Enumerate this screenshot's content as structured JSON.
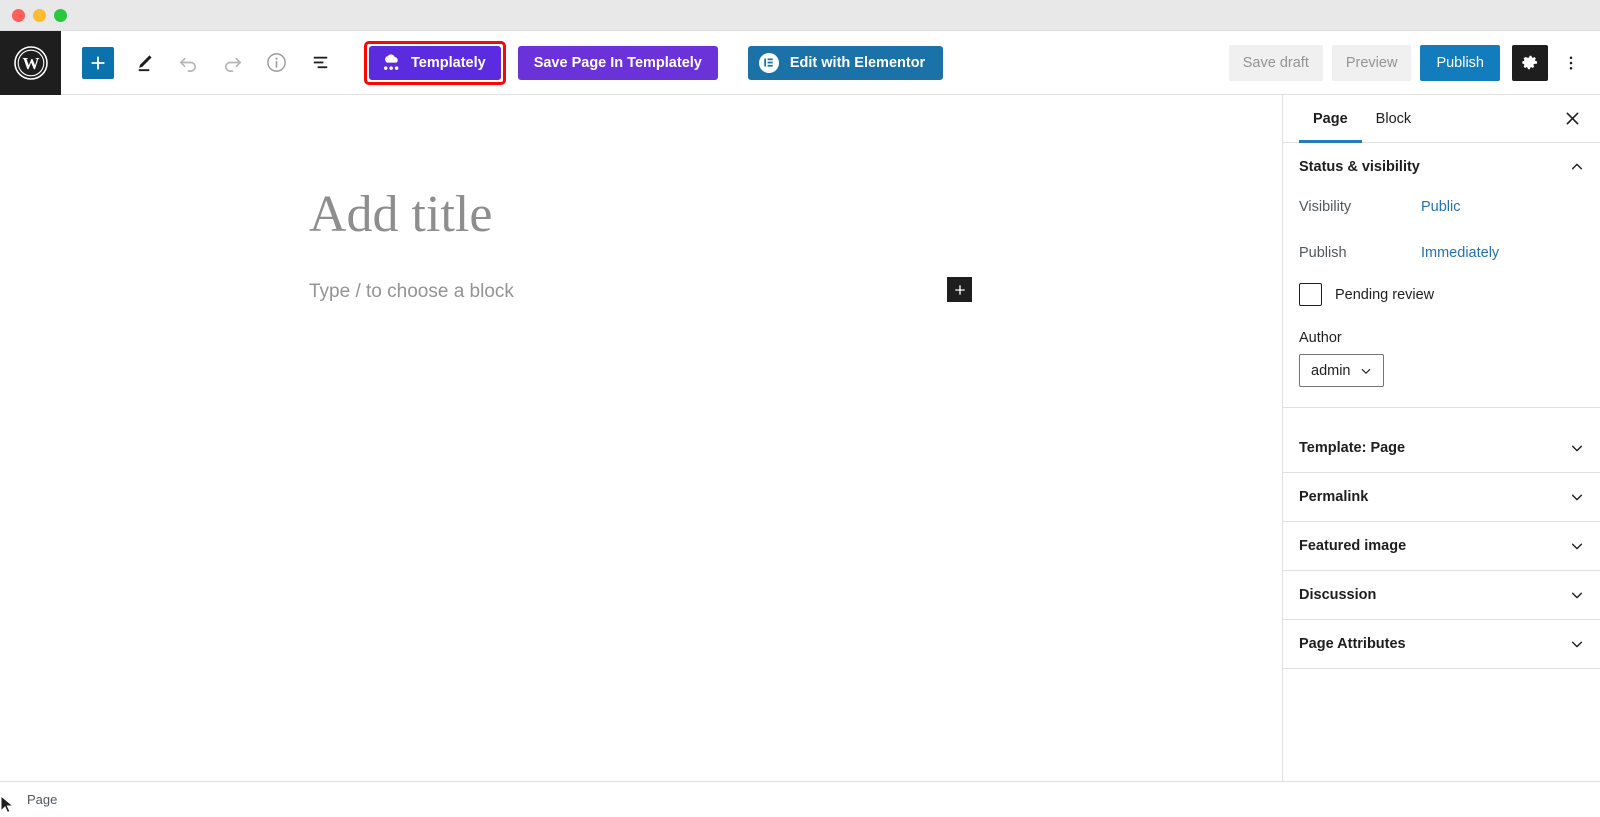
{
  "window": {
    "traffic_lights": [
      "close",
      "minimize",
      "maximize"
    ],
    "colors": {
      "close": "#ff5f57",
      "minimize": "#febc2e",
      "maximize": "#28c840"
    }
  },
  "toolbar": {
    "wp_logo": "wordpress-logo",
    "tools": [
      {
        "name": "block-inserter",
        "icon": "plus-icon",
        "label": "Toggle block inserter"
      },
      {
        "name": "tools-edit",
        "icon": "pencil-icon",
        "label": "Tools"
      },
      {
        "name": "undo",
        "icon": "undo-arrow-icon",
        "label": "Undo"
      },
      {
        "name": "redo",
        "icon": "redo-arrow-icon",
        "label": "Redo"
      },
      {
        "name": "details",
        "icon": "info-circle-icon",
        "label": "Details"
      },
      {
        "name": "list-view",
        "icon": "list-view-icon",
        "label": "List view"
      }
    ],
    "templately_label": "Templately",
    "save_page_templately_label": "Save Page In Templately",
    "edit_with_elementor_label": "Edit with Elementor",
    "save_draft_label": "Save draft",
    "preview_label": "Preview",
    "publish_label": "Publish",
    "settings_gear_label": "Settings",
    "more_options_label": "Options"
  },
  "highlight": {
    "target": "Templately",
    "border_color": "#fb0505"
  },
  "colors": {
    "templately_purple": "#5b2be0",
    "templately_save_purple": "#6a32d8",
    "elementor_blue": "#1a72a8",
    "publish_blue": "#137cbd",
    "inserter_blue": "#0b72ad",
    "accent_tab": "#1e7fb8",
    "link_blue": "#2271b1",
    "dark": "#1e1e1e"
  },
  "canvas": {
    "title_placeholder": "Add title",
    "block_placeholder": "Type / to choose a block",
    "inserter_icon": "plus-icon"
  },
  "sidebar": {
    "tabs": [
      {
        "label": "Page",
        "active": true
      },
      {
        "label": "Block",
        "active": false
      }
    ],
    "close_icon": "close-icon",
    "status_panel": {
      "title": "Status & visibility",
      "expanded": true,
      "rows": [
        {
          "label": "Visibility",
          "value": "Public"
        },
        {
          "label": "Publish",
          "value": "Immediately"
        }
      ],
      "pending_review": {
        "label": "Pending review",
        "checked": false
      },
      "author": {
        "label": "Author",
        "value": "admin"
      }
    },
    "panels": [
      {
        "title": "Template: Page",
        "expanded": false
      },
      {
        "title": "Permalink",
        "expanded": false
      },
      {
        "title": "Featured image",
        "expanded": false
      },
      {
        "title": "Discussion",
        "expanded": false
      },
      {
        "title": "Page Attributes",
        "expanded": false
      }
    ]
  },
  "footer": {
    "breadcrumb": "Page"
  }
}
